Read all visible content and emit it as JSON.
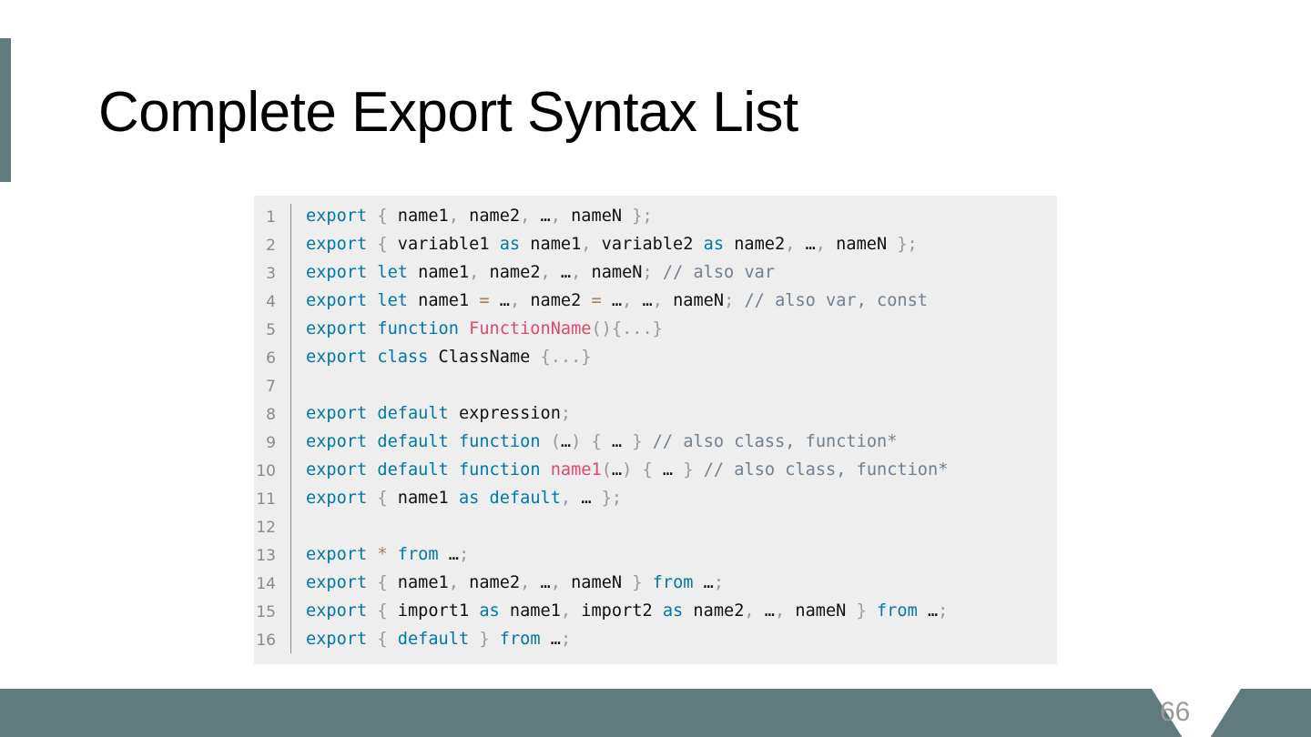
{
  "slide": {
    "title": "Complete Export Syntax List",
    "page_number": "66"
  },
  "code": {
    "line_numbers": [
      "1",
      "2",
      "3",
      "4",
      "5",
      "6",
      "7",
      "8",
      "9",
      "10",
      "11",
      "12",
      "13",
      "14",
      "15",
      "16"
    ],
    "lines": [
      [
        [
          "k",
          "export"
        ],
        [
          "t",
          " "
        ],
        [
          "p",
          "{"
        ],
        [
          "t",
          " name1"
        ],
        [
          "p",
          ","
        ],
        [
          "t",
          " name2"
        ],
        [
          "p",
          ","
        ],
        [
          "t",
          " …"
        ],
        [
          "p",
          ","
        ],
        [
          "t",
          " nameN "
        ],
        [
          "p",
          "};"
        ]
      ],
      [
        [
          "k",
          "export"
        ],
        [
          "t",
          " "
        ],
        [
          "p",
          "{"
        ],
        [
          "t",
          " variable1 "
        ],
        [
          "k",
          "as"
        ],
        [
          "t",
          " name1"
        ],
        [
          "p",
          ","
        ],
        [
          "t",
          " variable2 "
        ],
        [
          "k",
          "as"
        ],
        [
          "t",
          " name2"
        ],
        [
          "p",
          ","
        ],
        [
          "t",
          " …"
        ],
        [
          "p",
          ","
        ],
        [
          "t",
          " nameN "
        ],
        [
          "p",
          "};"
        ]
      ],
      [
        [
          "k",
          "export"
        ],
        [
          "t",
          " "
        ],
        [
          "k",
          "let"
        ],
        [
          "t",
          " name1"
        ],
        [
          "p",
          ","
        ],
        [
          "t",
          " name2"
        ],
        [
          "p",
          ","
        ],
        [
          "t",
          " …"
        ],
        [
          "p",
          ","
        ],
        [
          "t",
          " nameN"
        ],
        [
          "p",
          ";"
        ],
        [
          "t",
          " "
        ],
        [
          "c",
          "// also var"
        ]
      ],
      [
        [
          "k",
          "export"
        ],
        [
          "t",
          " "
        ],
        [
          "k",
          "let"
        ],
        [
          "t",
          " name1 "
        ],
        [
          "o",
          "="
        ],
        [
          "t",
          " …"
        ],
        [
          "p",
          ","
        ],
        [
          "t",
          " name2 "
        ],
        [
          "o",
          "="
        ],
        [
          "t",
          " …"
        ],
        [
          "p",
          ","
        ],
        [
          "t",
          " …"
        ],
        [
          "p",
          ","
        ],
        [
          "t",
          " nameN"
        ],
        [
          "p",
          ";"
        ],
        [
          "t",
          " "
        ],
        [
          "c",
          "// also var, const"
        ]
      ],
      [
        [
          "k",
          "export"
        ],
        [
          "t",
          " "
        ],
        [
          "k",
          "function"
        ],
        [
          "t",
          " "
        ],
        [
          "f",
          "FunctionName"
        ],
        [
          "p",
          "(){...}"
        ]
      ],
      [
        [
          "k",
          "export"
        ],
        [
          "t",
          " "
        ],
        [
          "k",
          "class"
        ],
        [
          "t",
          " ClassName "
        ],
        [
          "p",
          "{...}"
        ]
      ],
      [],
      [
        [
          "k",
          "export"
        ],
        [
          "t",
          " "
        ],
        [
          "k",
          "default"
        ],
        [
          "t",
          " expression"
        ],
        [
          "p",
          ";"
        ]
      ],
      [
        [
          "k",
          "export"
        ],
        [
          "t",
          " "
        ],
        [
          "k",
          "default"
        ],
        [
          "t",
          " "
        ],
        [
          "k",
          "function"
        ],
        [
          "t",
          " "
        ],
        [
          "p",
          "("
        ],
        [
          "t",
          "…"
        ],
        [
          "p",
          ")"
        ],
        [
          "t",
          " "
        ],
        [
          "p",
          "{"
        ],
        [
          "t",
          " … "
        ],
        [
          "p",
          "}"
        ],
        [
          "t",
          " "
        ],
        [
          "c",
          "// also class, function*"
        ]
      ],
      [
        [
          "k",
          "export"
        ],
        [
          "t",
          " "
        ],
        [
          "k",
          "default"
        ],
        [
          "t",
          " "
        ],
        [
          "k",
          "function"
        ],
        [
          "t",
          " "
        ],
        [
          "f",
          "name1"
        ],
        [
          "p",
          "("
        ],
        [
          "t",
          "…"
        ],
        [
          "p",
          ")"
        ],
        [
          "t",
          " "
        ],
        [
          "p",
          "{"
        ],
        [
          "t",
          " … "
        ],
        [
          "p",
          "}"
        ],
        [
          "t",
          " "
        ],
        [
          "c",
          "// also class, function*"
        ]
      ],
      [
        [
          "k",
          "export"
        ],
        [
          "t",
          " "
        ],
        [
          "p",
          "{"
        ],
        [
          "t",
          " name1 "
        ],
        [
          "k",
          "as"
        ],
        [
          "t",
          " "
        ],
        [
          "k",
          "default"
        ],
        [
          "p",
          ","
        ],
        [
          "t",
          " … "
        ],
        [
          "p",
          "};"
        ]
      ],
      [],
      [
        [
          "k",
          "export"
        ],
        [
          "t",
          " "
        ],
        [
          "o",
          "*"
        ],
        [
          "t",
          " "
        ],
        [
          "k",
          "from"
        ],
        [
          "t",
          " …"
        ],
        [
          "p",
          ";"
        ]
      ],
      [
        [
          "k",
          "export"
        ],
        [
          "t",
          " "
        ],
        [
          "p",
          "{"
        ],
        [
          "t",
          " name1"
        ],
        [
          "p",
          ","
        ],
        [
          "t",
          " name2"
        ],
        [
          "p",
          ","
        ],
        [
          "t",
          " …"
        ],
        [
          "p",
          ","
        ],
        [
          "t",
          " nameN "
        ],
        [
          "p",
          "}"
        ],
        [
          "t",
          " "
        ],
        [
          "k",
          "from"
        ],
        [
          "t",
          " …"
        ],
        [
          "p",
          ";"
        ]
      ],
      [
        [
          "k",
          "export"
        ],
        [
          "t",
          " "
        ],
        [
          "p",
          "{"
        ],
        [
          "t",
          " import1 "
        ],
        [
          "k",
          "as"
        ],
        [
          "t",
          " name1"
        ],
        [
          "p",
          ","
        ],
        [
          "t",
          " import2 "
        ],
        [
          "k",
          "as"
        ],
        [
          "t",
          " name2"
        ],
        [
          "p",
          ","
        ],
        [
          "t",
          " …"
        ],
        [
          "p",
          ","
        ],
        [
          "t",
          " nameN "
        ],
        [
          "p",
          "}"
        ],
        [
          "t",
          " "
        ],
        [
          "k",
          "from"
        ],
        [
          "t",
          " …"
        ],
        [
          "p",
          ";"
        ]
      ],
      [
        [
          "k",
          "export"
        ],
        [
          "t",
          " "
        ],
        [
          "p",
          "{"
        ],
        [
          "t",
          " "
        ],
        [
          "k",
          "default"
        ],
        [
          "t",
          " "
        ],
        [
          "p",
          "}"
        ],
        [
          "t",
          " "
        ],
        [
          "k",
          "from"
        ],
        [
          "t",
          " …"
        ],
        [
          "p",
          ";"
        ]
      ]
    ]
  }
}
